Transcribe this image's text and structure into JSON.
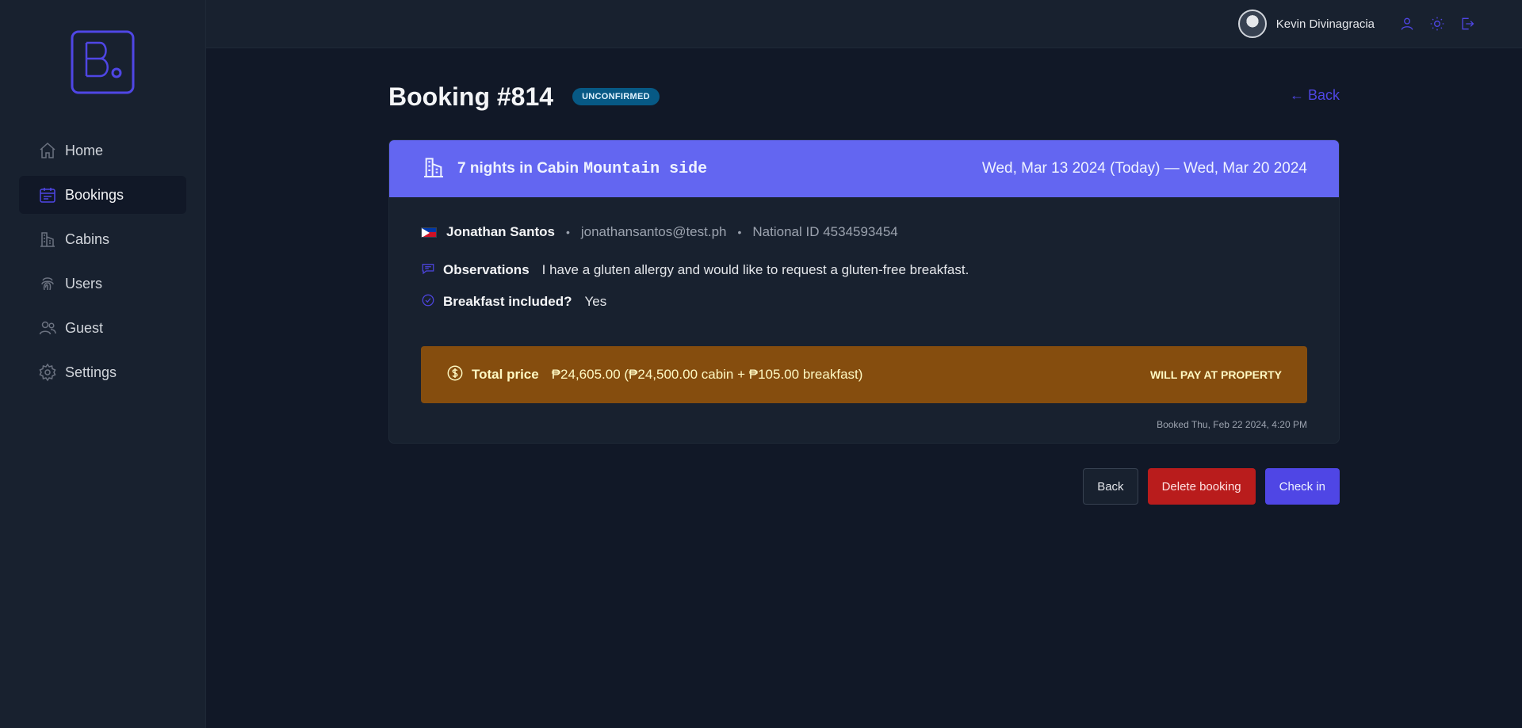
{
  "user": {
    "name": "Kevin Divinagracia"
  },
  "sidebar": {
    "items": [
      {
        "label": "Home",
        "icon": "home-icon"
      },
      {
        "label": "Bookings",
        "icon": "calendar-icon",
        "active": true
      },
      {
        "label": "Cabins",
        "icon": "building-icon"
      },
      {
        "label": "Users",
        "icon": "fingerprint-icon"
      },
      {
        "label": "Guest",
        "icon": "users-icon"
      },
      {
        "label": "Settings",
        "icon": "gear-icon"
      }
    ]
  },
  "page": {
    "title": "Booking #814",
    "status": "unconfirmed",
    "back_link": "← Back"
  },
  "booking": {
    "nights_text": "7 nights in Cabin",
    "cabin_name": "Mountain side",
    "dates": "Wed, Mar 13 2024 (Today) — Wed, Mar 20 2024",
    "guest": {
      "name": "Jonathan Santos",
      "email": "jonathansantos@test.ph",
      "national_id": "National ID 4534593454",
      "country_flag": "philippines-flag"
    },
    "observations_label": "Observations",
    "observations": "I have a gluten allergy and would like to request a gluten-free breakfast.",
    "breakfast_label": "Breakfast included?",
    "breakfast_value": "Yes",
    "price_label": "Total price",
    "price_value": "₱24,605.00 (₱24,500.00 cabin + ₱105.00 breakfast)",
    "payment_status": "Will pay at property",
    "booked_at": "Booked Thu, Feb 22 2024, 4:20 PM"
  },
  "actions": {
    "back": "Back",
    "delete": "Delete booking",
    "check_in": "Check in"
  },
  "colors": {
    "accent": "#4f46e5",
    "card_header": "#6366f1",
    "price_box": "#854d0e",
    "delete": "#b91c1c",
    "badge": "#075985"
  }
}
